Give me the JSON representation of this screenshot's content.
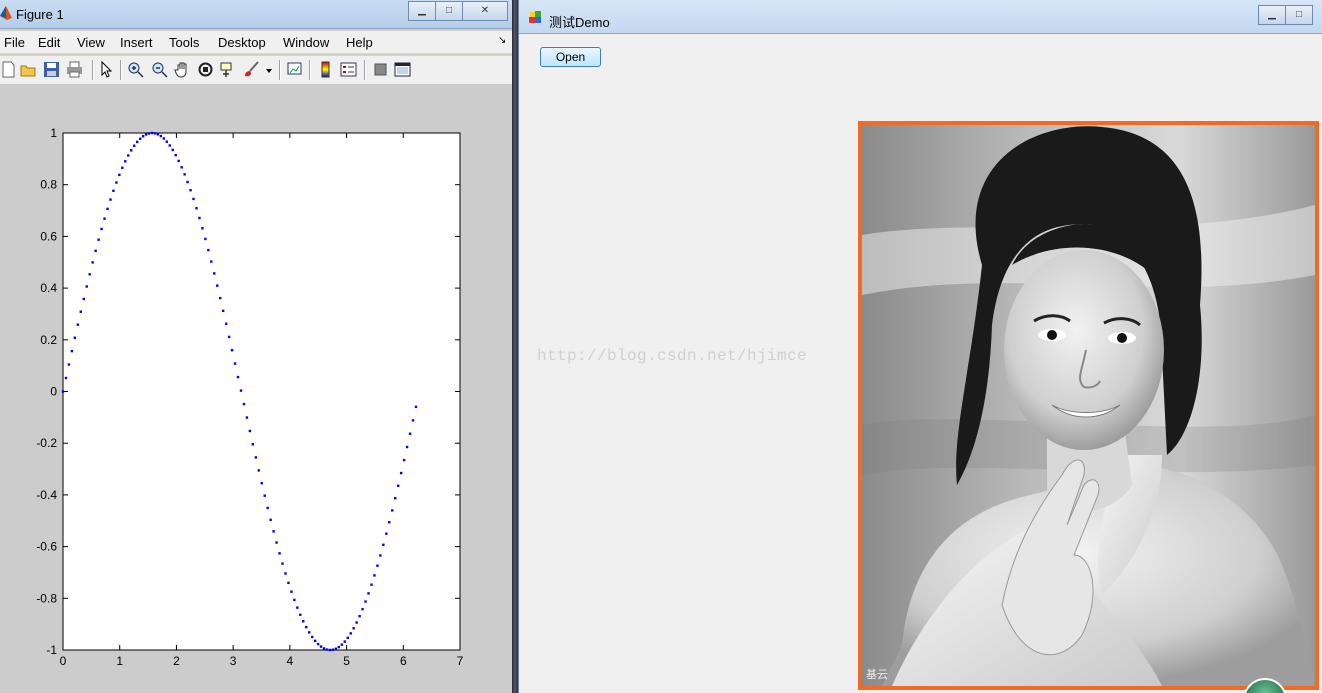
{
  "figure_window": {
    "title": "Figure 1",
    "menu": [
      "File",
      "Edit",
      "View",
      "Insert",
      "Tools",
      "Desktop",
      "Window",
      "Help"
    ],
    "menu_overflow_glyph": "↘",
    "toolbar_icons": [
      "new-figure-icon",
      "open-file-icon",
      "save-icon",
      "print-icon",
      "select-arrow-icon",
      "zoom-in-icon",
      "zoom-out-icon",
      "pan-hand-icon",
      "rotate-3d-icon",
      "data-cursor-icon",
      "brush-icon",
      "link-plot-icon",
      "colorbar-icon",
      "legend-icon",
      "hide-plot-tools-icon",
      "show-plot-tools-icon"
    ]
  },
  "chart_data": {
    "type": "scatter",
    "function": "sin(x)",
    "x_range": [
      0,
      6.25
    ],
    "x_step": 0.0523,
    "xlim": [
      0,
      7
    ],
    "ylim": [
      -1,
      1
    ],
    "xticks": [
      "0",
      "1",
      "2",
      "3",
      "4",
      "5",
      "6",
      "7"
    ],
    "yticks": [
      "1",
      "0.8",
      "0.6",
      "0.4",
      "0.2",
      "0",
      "-0.2",
      "-0.4",
      "-0.6",
      "-0.8",
      "-1"
    ],
    "xtick_values": [
      0,
      1,
      2,
      3,
      4,
      5,
      6,
      7
    ],
    "ytick_values": [
      1,
      0.8,
      0.6,
      0.4,
      0.2,
      0,
      -0.2,
      -0.4,
      -0.6,
      -0.8,
      -1
    ],
    "marker": "dot",
    "color": "#0000ff",
    "grid": false,
    "title": "",
    "xlabel": "",
    "ylabel": ""
  },
  "demo_window": {
    "title": "测试Demo",
    "open_button_label": "Open",
    "watermark": "http://blog.csdn.net/hjimce",
    "image_frame_color": "#f26b26",
    "photo_caption_mark": "基云"
  }
}
